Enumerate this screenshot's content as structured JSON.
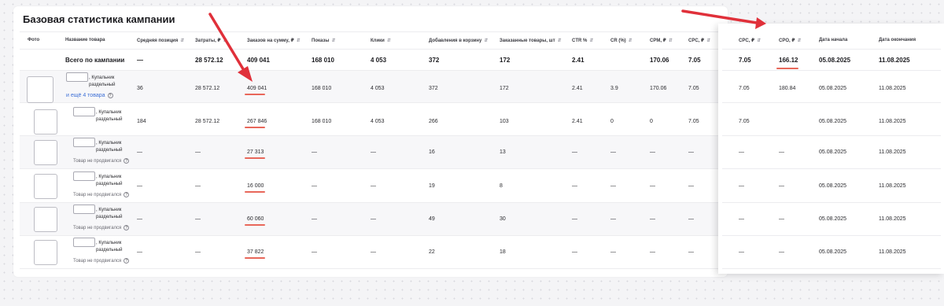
{
  "title": "Базовая статистика кампании",
  "headers": {
    "photo": "Фото",
    "name": "Название товара",
    "avg_pos": "Средняя позиция",
    "spend": "Затраты, ₽",
    "orders_sum": "Заказов на сумму, ₽",
    "views": "Показы",
    "clicks": "Клики",
    "cart": "Добавления в корзину",
    "ordered": "Заказанные товары, шт",
    "ctr": "CTR %",
    "cr": "CR (%)",
    "cpm": "CPM, ₽",
    "cpc": "CPC, ₽"
  },
  "side_headers": {
    "cpc": "CPC, ₽",
    "cpo": "CPO, ₽",
    "start": "Дата начала",
    "end": "Дата окончания"
  },
  "total": {
    "label": "Всего по кампании",
    "avg_pos": "—",
    "spend": "28 572.12",
    "orders_sum": "409 041",
    "views": "168 010",
    "clicks": "4 053",
    "cart": "372",
    "ordered": "172",
    "ctr": "2.41",
    "cr": "",
    "cpm": "170.06",
    "cpc": "7.05",
    "side_cpc": "7.05",
    "side_cpo": "166.12",
    "start": "05.08.2025",
    "end": "11.08.2025"
  },
  "rows": [
    {
      "name": ", Купальник раздельный",
      "sub": "и ещё 4 товара",
      "avg_pos": "36",
      "spend": "28 572.12",
      "orders_sum": "409 041",
      "views": "168 010",
      "clicks": "4 053",
      "cart": "372",
      "ordered": "172",
      "ctr": "2.41",
      "cr": "3.9",
      "cpm": "170.06",
      "cpc": "7.05",
      "side_cpc": "7.05",
      "side_cpo": "180.84",
      "start": "05.08.2025",
      "end": "11.08.2025"
    },
    {
      "name": ", Купальник раздельный",
      "sub": "",
      "avg_pos": "184",
      "spend": "28 572.12",
      "orders_sum": "267 846",
      "views": "168 010",
      "clicks": "4 053",
      "cart": "266",
      "ordered": "103",
      "ctr": "2.41",
      "cr": "0",
      "cpm": "0",
      "cpc": "7.05",
      "side_cpc": "7.05",
      "side_cpo": "",
      "start": "05.08.2025",
      "end": "11.08.2025"
    },
    {
      "name": ", Купальник раздельный",
      "sub": "Товар не продвигался",
      "avg_pos": "—",
      "spend": "—",
      "orders_sum": "27 313",
      "views": "—",
      "clicks": "—",
      "cart": "16",
      "ordered": "13",
      "ctr": "—",
      "cr": "—",
      "cpm": "—",
      "cpc": "—",
      "side_cpc": "—",
      "side_cpo": "—",
      "start": "05.08.2025",
      "end": "11.08.2025"
    },
    {
      "name": ", Купальник раздельный",
      "sub": "Товар не продвигался",
      "avg_pos": "—",
      "spend": "—",
      "orders_sum": "16 000",
      "views": "—",
      "clicks": "—",
      "cart": "19",
      "ordered": "8",
      "ctr": "—",
      "cr": "—",
      "cpm": "—",
      "cpc": "—",
      "side_cpc": "—",
      "side_cpo": "—",
      "start": "05.08.2025",
      "end": "11.08.2025"
    },
    {
      "name": ", Купальник раздельный",
      "sub": "Товар не продвигался",
      "avg_pos": "—",
      "spend": "—",
      "orders_sum": "60 060",
      "views": "—",
      "clicks": "—",
      "cart": "49",
      "ordered": "30",
      "ctr": "—",
      "cr": "—",
      "cpm": "—",
      "cpc": "—",
      "side_cpc": "—",
      "side_cpo": "—",
      "start": "05.08.2025",
      "end": "11.08.2025"
    },
    {
      "name": ", Купальник раздельный",
      "sub": "Товар не продвигался",
      "avg_pos": "—",
      "spend": "—",
      "orders_sum": "37 822",
      "views": "—",
      "clicks": "—",
      "cart": "22",
      "ordered": "18",
      "ctr": "—",
      "cr": "—",
      "cpm": "—",
      "cpc": "—",
      "side_cpc": "—",
      "side_cpo": "—",
      "start": "05.08.2025",
      "end": "11.08.2025"
    }
  ],
  "icons": {
    "sort": "sort-icon",
    "help": "question-circle-icon"
  },
  "colors": {
    "accent_underline": "#e8675a",
    "annotation_arrow": "#e0303a",
    "link": "#3d6fd6"
  }
}
